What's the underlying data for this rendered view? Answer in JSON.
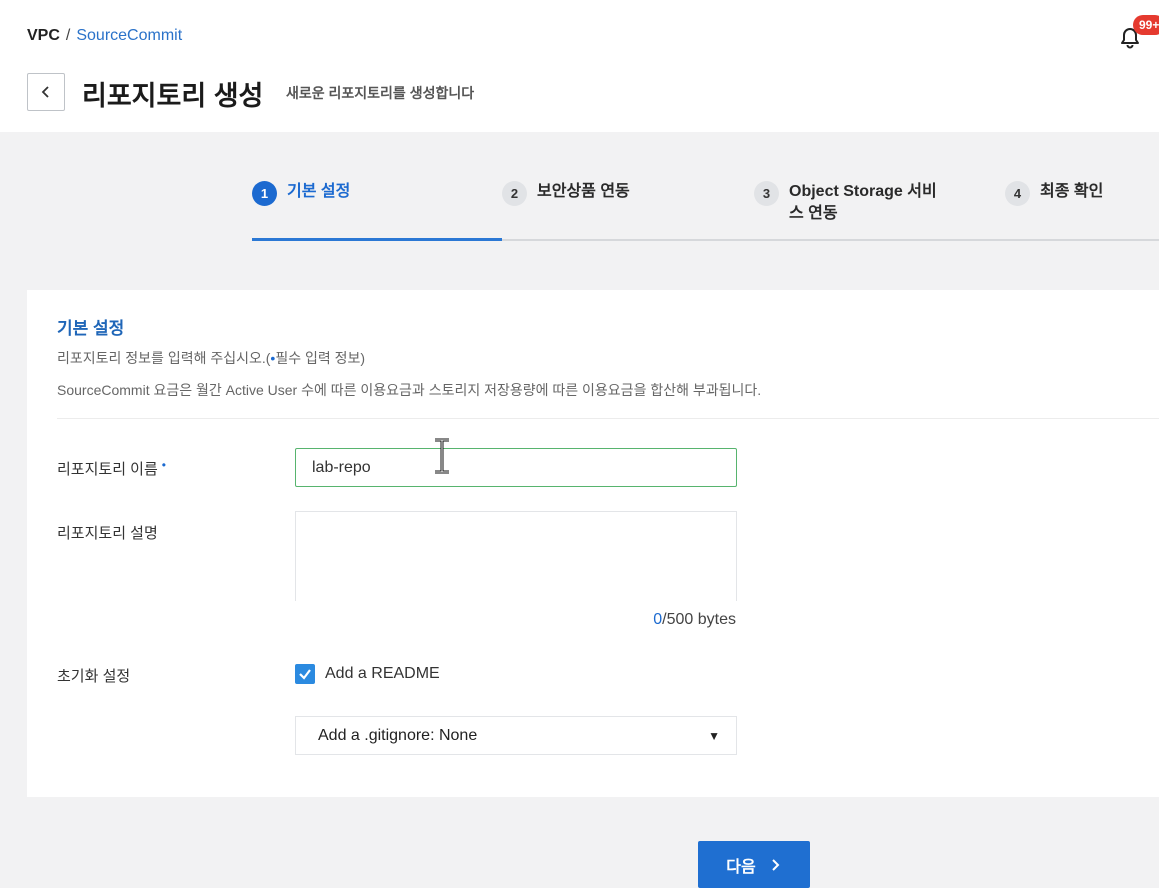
{
  "breadcrumb": {
    "root": "VPC",
    "separator": "/",
    "current": "SourceCommit"
  },
  "notifications": {
    "badge": "99+",
    "icon": "bell-icon"
  },
  "header": {
    "back_icon": "chevron-left-icon",
    "title": "리포지토리 생성",
    "subtitle": "새로운 리포지토리를 생성합니다"
  },
  "stepper": {
    "steps": [
      {
        "num": "1",
        "label": "기본 설정",
        "active": true
      },
      {
        "num": "2",
        "label": "보안상품 연동",
        "active": false
      },
      {
        "num": "3",
        "label": "Object Storage 서비스 연동",
        "active": false
      },
      {
        "num": "4",
        "label": "최종 확인",
        "active": false
      }
    ]
  },
  "section": {
    "title": "기본 설정",
    "desc1_prefix": "리포지토리 정보를 입력해 주십시오.(",
    "desc1_dot": "•",
    "desc1_suffix": "필수 입력 정보)",
    "desc2": "SourceCommit 요금은 월간 Active User 수에 따른 이용요금과 스토리지 저장용량에 따른 이용요금을 합산해 부과됩니다."
  },
  "form": {
    "name_label": "리포지토리 이름",
    "required_dot": "•",
    "name_value": "lab-repo",
    "desc_label": "리포지토리 설명",
    "desc_value": "",
    "byte_current": "0",
    "byte_suffix": "/500 bytes",
    "init_label": "초기화 설정",
    "readme_label": "Add a README",
    "readme_checked": true,
    "gitignore_value": "Add a .gitignore: None"
  },
  "footer": {
    "next_label": "다음",
    "next_icon": "chevron-right-icon"
  },
  "colors": {
    "accent": "#1f6fd1",
    "input_focus": "#57b46e",
    "badge": "#e53a2f"
  }
}
